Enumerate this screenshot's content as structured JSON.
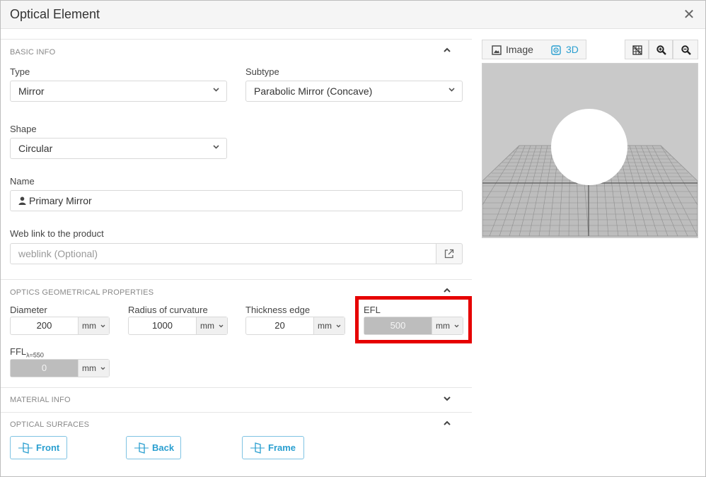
{
  "dialog": {
    "title": "Optical Element",
    "close_glyph": "✕"
  },
  "basic_info": {
    "header": "BASIC INFO",
    "type_label": "Type",
    "type_value": "Mirror",
    "subtype_label": "Subtype",
    "subtype_value": "Parabolic Mirror (Concave)",
    "shape_label": "Shape",
    "shape_value": "Circular",
    "name_label": "Name",
    "name_value": "Primary Mirror",
    "weblink_label": "Web link to the product",
    "weblink_placeholder": "weblink (Optional)"
  },
  "geometry": {
    "header": "OPTICS GEOMETRICAL PROPERTIES",
    "diameter_label": "Diameter",
    "diameter_value": "200",
    "diameter_unit": "mm",
    "radius_label": "Radius of curvature",
    "radius_value": "1000",
    "radius_unit": "mm",
    "thickness_label": "Thickness edge",
    "thickness_value": "20",
    "thickness_unit": "mm",
    "efl_label": "EFL",
    "efl_value": "500",
    "efl_unit": "mm",
    "ffl_label": "FFL",
    "ffl_subscript": "λ=550",
    "ffl_value": "0",
    "ffl_unit": "mm"
  },
  "material": {
    "header": "MATERIAL INFO"
  },
  "surfaces": {
    "header": "OPTICAL SURFACES",
    "front_label": "Front",
    "back_label": "Back",
    "frame_label": "Frame"
  },
  "viewer": {
    "image_tab": "Image",
    "threed_tab": "3D",
    "icons": [
      "grid-icon",
      "zoom-in-icon",
      "zoom-out-icon"
    ]
  },
  "colors": {
    "accent": "#2a9fd0",
    "highlight": "#e60000"
  }
}
